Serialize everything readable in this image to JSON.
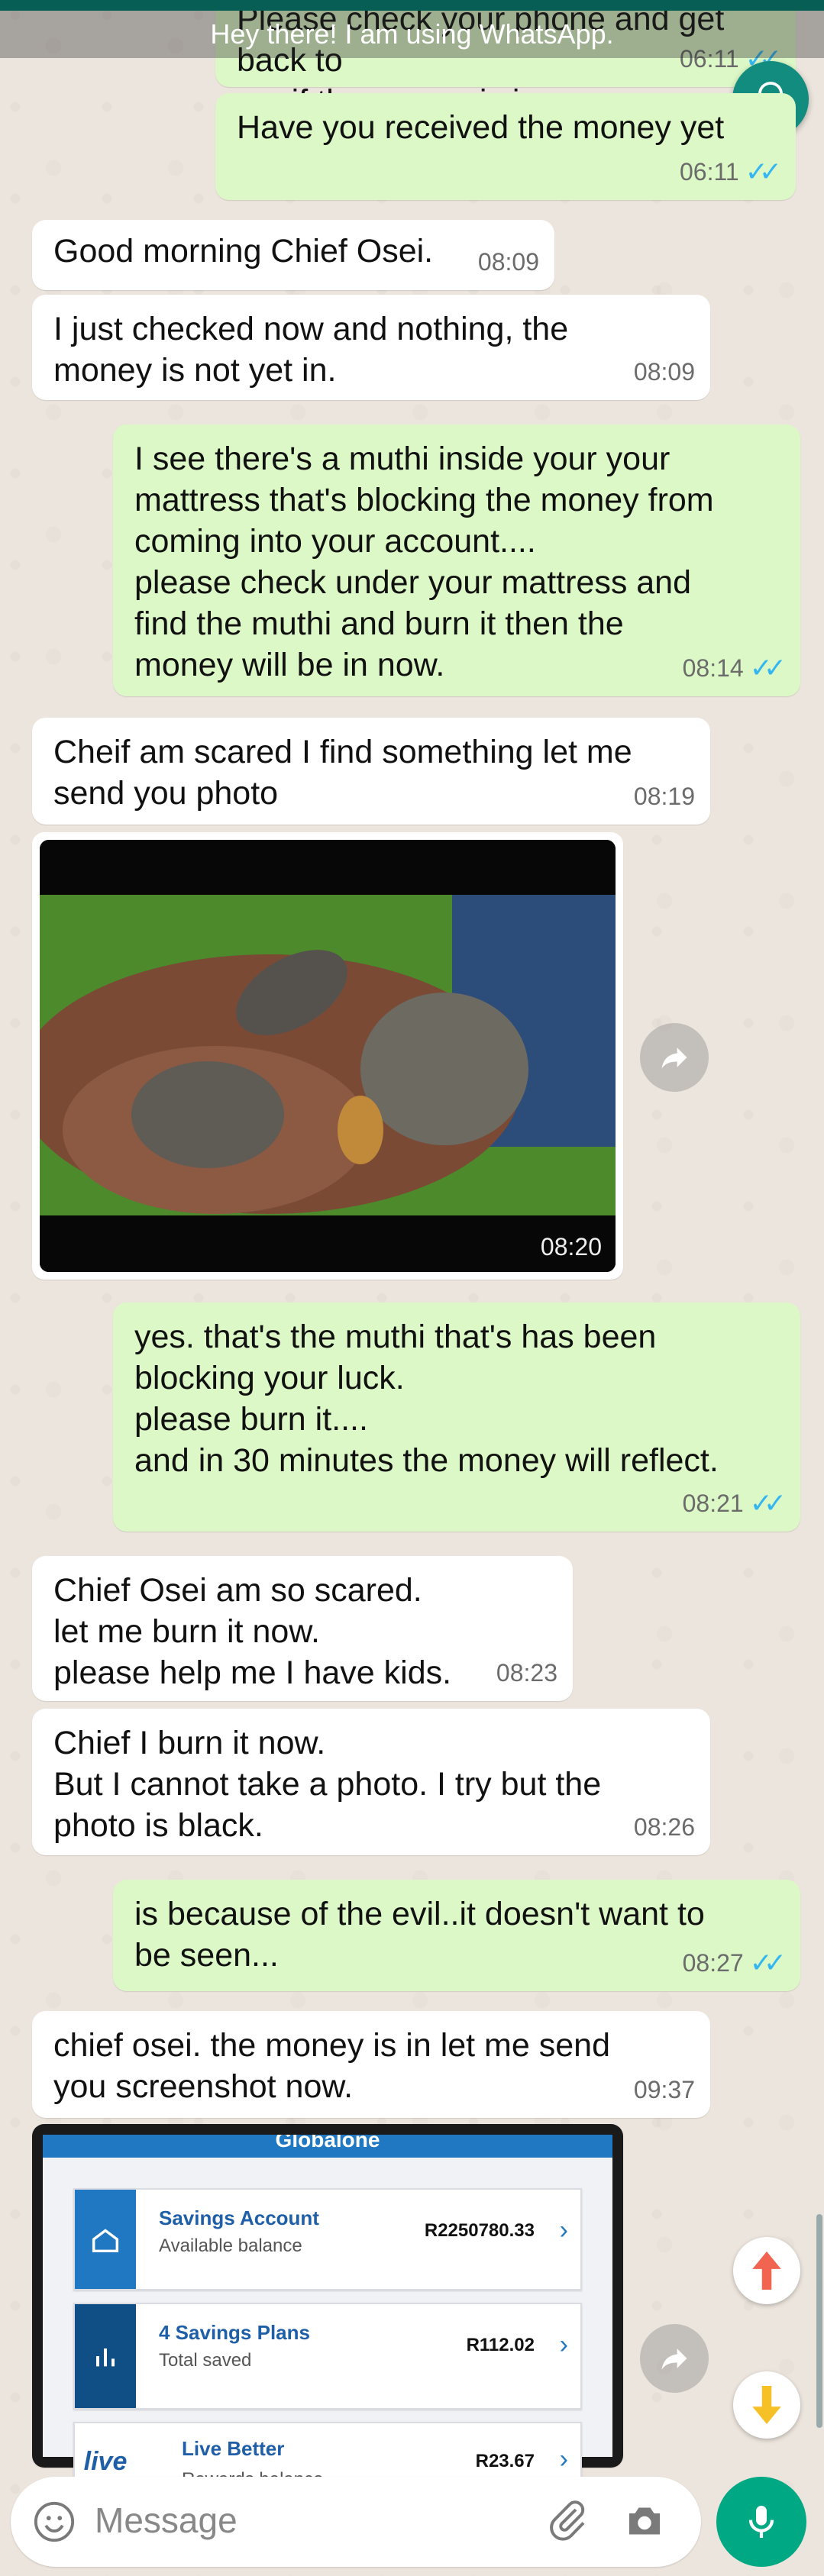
{
  "status_banner": "Hey there! I am using WhatsApp.",
  "messages": [
    {
      "id": "m0",
      "dir": "out",
      "text": "Please check your phone and get back to\nme if the money is in...",
      "time": "06:11",
      "ticks": true
    },
    {
      "id": "m1",
      "dir": "out",
      "text": "Have you received the money yet",
      "time": "06:11",
      "ticks": true
    },
    {
      "id": "m2",
      "dir": "in",
      "text": "Good morning Chief Osei.",
      "time": "08:09"
    },
    {
      "id": "m3",
      "dir": "in",
      "text": "I just checked now and nothing, the\nmoney is not yet in.",
      "time": "08:09"
    },
    {
      "id": "m4",
      "dir": "out",
      "text": "I see there's a muthi inside your your\nmattress that's blocking the money from\ncoming into your account....\nplease check under your mattress and\nfind the muthi and burn it then the\nmoney will be in now.",
      "time": "08:14",
      "ticks": true
    },
    {
      "id": "m5",
      "dir": "in",
      "text": "Cheif am scared I find something let me\nsend you photo",
      "time": "08:19"
    },
    {
      "id": "m6",
      "dir": "in",
      "type": "photo",
      "time": "08:20"
    },
    {
      "id": "m7",
      "dir": "out",
      "text": "yes. that's the muthi that's has been\nblocking your luck.\nplease burn it....\nand in 30 minutes the money will reflect.",
      "time": "08:21",
      "ticks": true
    },
    {
      "id": "m8",
      "dir": "in",
      "text": "Chief Osei am so scared.\nlet me burn it now.\nplease help me I have kids.",
      "time": "08:23"
    },
    {
      "id": "m9",
      "dir": "in",
      "text": "Chief I burn it now.\nBut I cannot take a photo. I try but the\nphoto is black.",
      "time": "08:26"
    },
    {
      "id": "m10",
      "dir": "out",
      "text": "is because of the evil..it doesn't want to\nbe seen...",
      "time": "08:27",
      "ticks": true
    },
    {
      "id": "m11",
      "dir": "in",
      "text": "chief osei. the money is in let me send\nyou screenshot now.",
      "time": "09:37"
    }
  ],
  "screenshot": {
    "header": "Globalone",
    "accounts": [
      {
        "title": "Savings Account",
        "subtitle": "Available balance",
        "amount": "R2250780.33"
      },
      {
        "title": "4 Savings Plans",
        "subtitle": "Total saved",
        "amount": "R112.02"
      },
      {
        "title": "Live Better",
        "subtitle": "Rewards balance",
        "amount": "R23.67"
      }
    ]
  },
  "composer": {
    "placeholder": "Message"
  },
  "colors": {
    "incoming": "#ffffff",
    "outgoing": "#dcf8c6",
    "ticks": "#34b7f1",
    "mic": "#00a884"
  }
}
